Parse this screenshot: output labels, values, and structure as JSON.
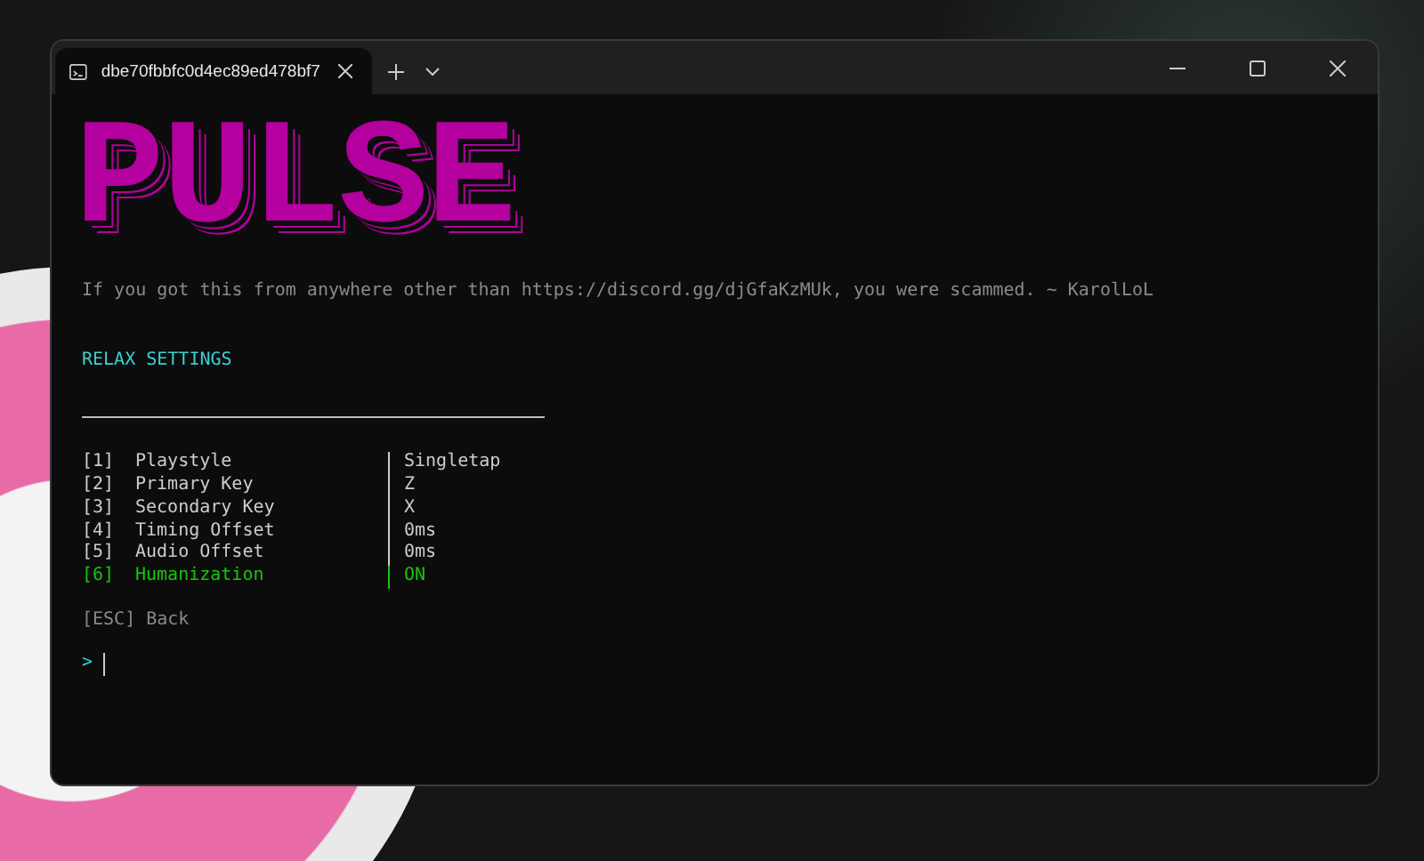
{
  "window": {
    "tab_title": "dbe70fbbfc0d4ec89ed478bf7"
  },
  "logo": "PULSE",
  "disclaimer": "If you got this from anywhere other than https://discord.gg/djGfaKzMUk, you were scammed. ~ KarolLoL",
  "section_title": "RELAX SETTINGS",
  "settings": [
    {
      "key": "[1]",
      "label": "Playstyle",
      "value": "Singletap",
      "selected": false
    },
    {
      "key": "[2]",
      "label": "Primary Key",
      "value": "Z",
      "selected": false
    },
    {
      "key": "[3]",
      "label": "Secondary Key",
      "value": "X",
      "selected": false
    },
    {
      "key": "[4]",
      "label": "Timing Offset",
      "value": "0ms",
      "selected": false
    },
    {
      "key": "[5]",
      "label": "Audio Offset",
      "value": "0ms",
      "selected": false
    },
    {
      "key": "[6]",
      "label": "Humanization",
      "value": "ON",
      "selected": true
    }
  ],
  "back": "[ESC] Back",
  "prompt": ">"
}
